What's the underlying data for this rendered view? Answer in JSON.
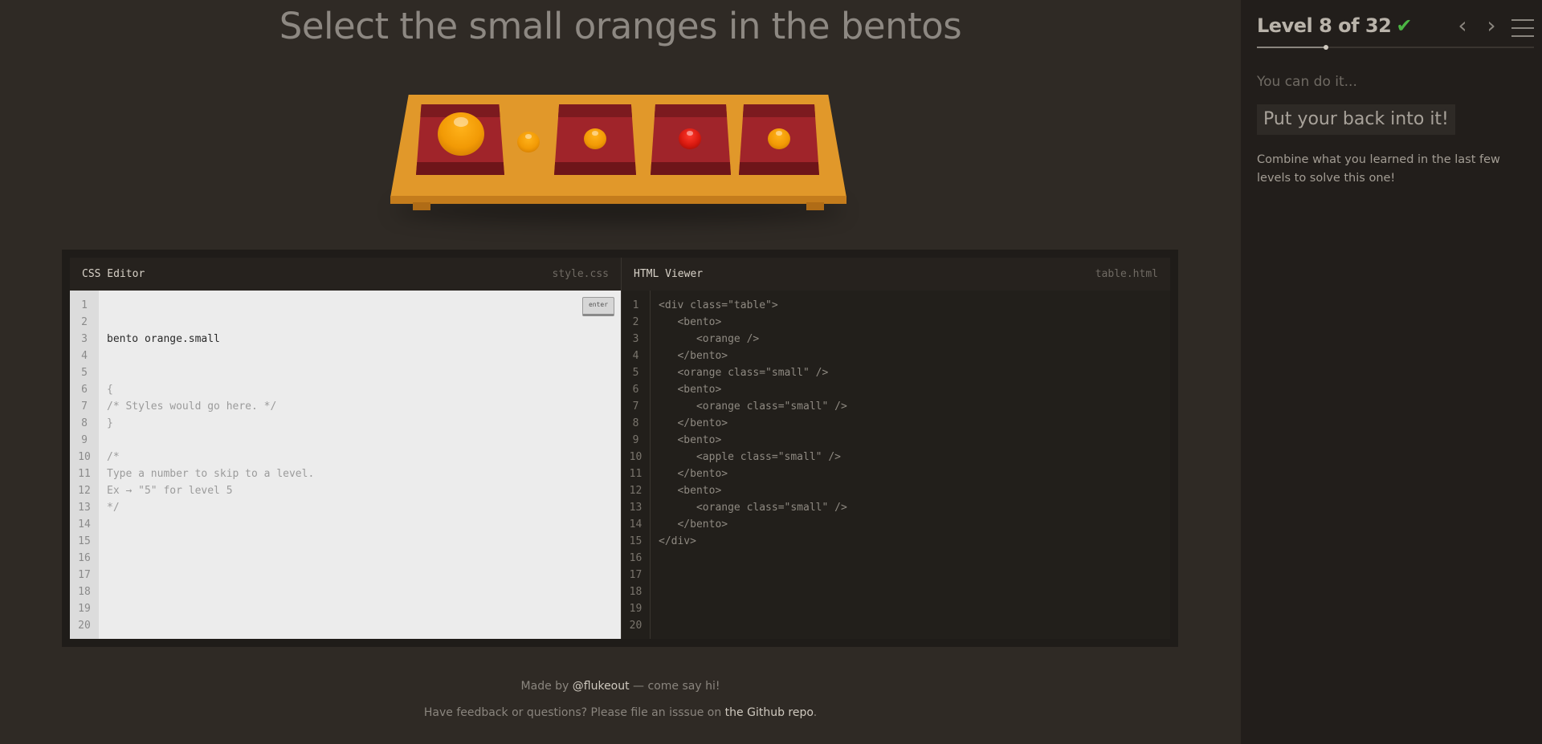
{
  "instruction": "Select the small oranges in the bentos",
  "css_editor": {
    "title": "CSS Editor",
    "filename": "style.css",
    "input_value": "bento orange.small",
    "enter_label": "enter",
    "line_numbers": [
      "1",
      "2",
      "3",
      "4",
      "5",
      "6",
      "7",
      "8",
      "9",
      "10",
      "11",
      "12",
      "13",
      "14",
      "15",
      "16",
      "17",
      "18",
      "19",
      "20"
    ],
    "code_lines": [
      "",
      "{",
      "/* Styles would go here. */",
      "}",
      "",
      "/*",
      "Type a number to skip to a level.",
      "Ex → \"5\" for level 5",
      "*/"
    ]
  },
  "html_viewer": {
    "title": "HTML Viewer",
    "filename": "table.html",
    "line_numbers": [
      "1",
      "2",
      "3",
      "4",
      "5",
      "6",
      "7",
      "8",
      "9",
      "10",
      "11",
      "12",
      "13",
      "14",
      "15",
      "16",
      "17",
      "18",
      "19",
      "20"
    ],
    "code_lines": [
      "<div class=\"table\">",
      "   <bento>",
      "      <orange />",
      "   </bento>",
      "   <orange class=\"small\" />",
      "   <bento>",
      "      <orange class=\"small\" />",
      "   </bento>",
      "   <bento>",
      "      <apple class=\"small\" />",
      "   </bento>",
      "   <bento>",
      "      <orange class=\"small\" />",
      "   </bento>",
      "</div>"
    ]
  },
  "footer": {
    "line1_prefix": "Made by ",
    "line1_link": "@flukeout",
    "line1_suffix": " — come say hi!",
    "line2_prefix": "Have feedback or questions? Please file an isssue on ",
    "line2_link": "the Github repo",
    "line2_suffix": "."
  },
  "sidebar": {
    "level_text": "Level 8 of 32",
    "completed": true,
    "check_icon": "checkmark-icon",
    "prev_icon": "chevron-left-icon",
    "next_icon": "chevron-right-icon",
    "menu_icon": "hamburger-menu-icon",
    "progress_fraction": 0.25,
    "hint_lead": "You can do it...",
    "hint_big": "Put your back into it!",
    "description": "Combine what you learned in the last few levels to solve this one!"
  },
  "colors": {
    "background": "#2f2a25",
    "sidebar": "#221e1b",
    "table": "#e1982a",
    "bento": "#a0242a",
    "orange": "#f29a05",
    "apple": "#d8190f",
    "check": "#4bb543"
  }
}
